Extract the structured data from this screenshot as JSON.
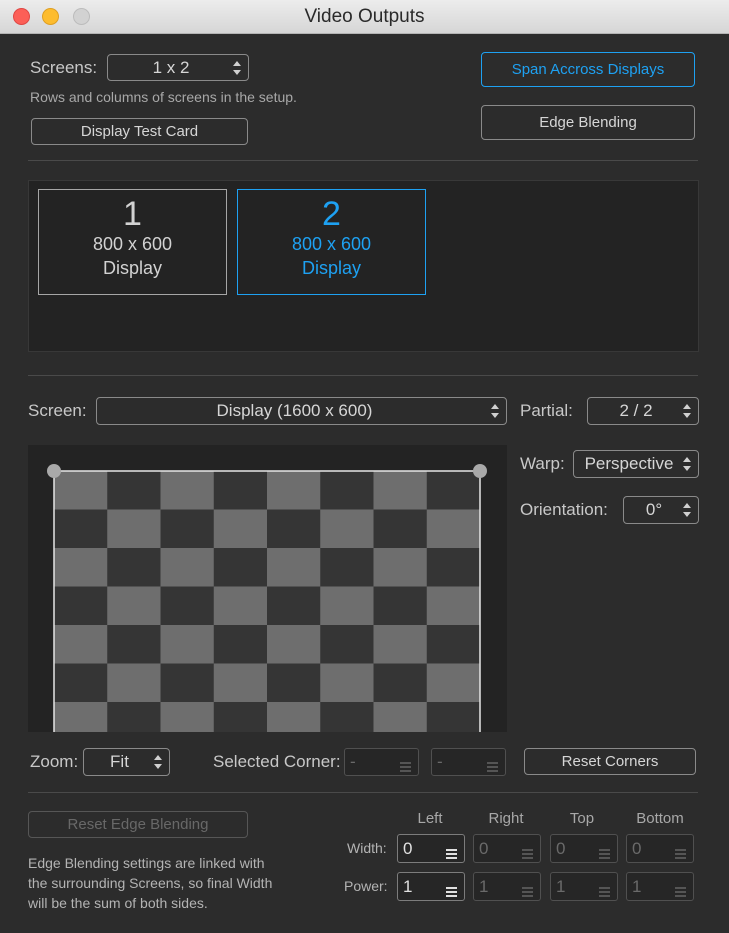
{
  "window": {
    "title": "Video Outputs"
  },
  "screens": {
    "label": "Screens:",
    "value": "1 x 2",
    "hint": "Rows and columns of screens in the setup.",
    "test_card_button": "Display Test Card",
    "span_button": "Span Accross Displays",
    "edge_blending_button": "Edge Blending"
  },
  "displays": [
    {
      "number": "1",
      "resolution": "800 x 600",
      "name": "Display"
    },
    {
      "number": "2",
      "resolution": "800 x 600",
      "name": "Display"
    }
  ],
  "screen_select": {
    "label": "Screen:",
    "value": "Display (1600 x 600)"
  },
  "partial": {
    "label": "Partial:",
    "value": "2 / 2"
  },
  "warp": {
    "label": "Warp:",
    "value": "Perspective"
  },
  "orientation": {
    "label": "Orientation:",
    "value": "0°"
  },
  "zoom": {
    "label": "Zoom:",
    "value": "Fit"
  },
  "selected_corner": {
    "label": "Selected Corner:",
    "x": "-",
    "y": "-"
  },
  "reset_corners_button": "Reset Corners",
  "edge": {
    "reset_button": "Reset Edge Blending",
    "note": [
      "Edge Blending settings are linked with",
      "the surrounding Screens, so final Width",
      "will be the sum of both sides."
    ],
    "columns": [
      "Left",
      "Right",
      "Top",
      "Bottom"
    ],
    "width_label": "Width:",
    "power_label": "Power:",
    "width_values": [
      "0",
      "0",
      "0",
      "0"
    ],
    "power_values": [
      "1",
      "1",
      "1",
      "1"
    ]
  },
  "colors": {
    "accent": "#1ea1f2",
    "background": "#2c2c2c",
    "checker_light": "#6e6e6e",
    "checker_dark": "#353535"
  },
  "icons": {
    "updown": "up-down-arrows-icon",
    "stepper": "hamburger-stepper-icon"
  }
}
